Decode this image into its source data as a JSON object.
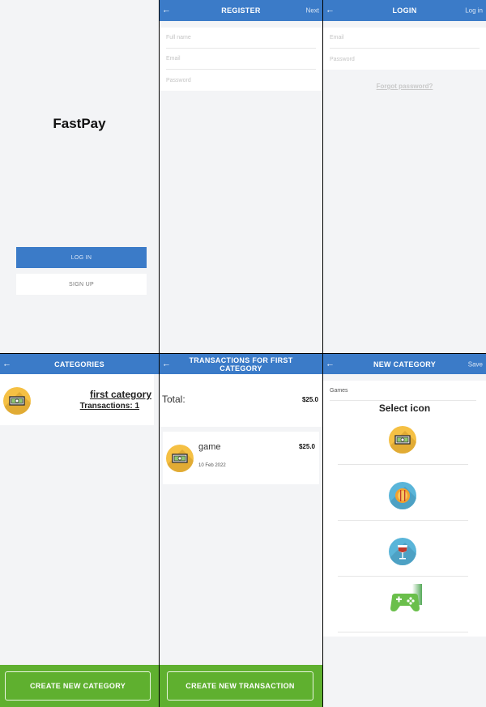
{
  "splash": {
    "brand": "FastPay",
    "login_label": "LOG IN",
    "signup_label": "SIGN UP"
  },
  "register": {
    "title": "REGISTER",
    "back_icon": "arrow-left-icon",
    "next_label": "Next",
    "fields": [
      {
        "placeholder": "Full name"
      },
      {
        "placeholder": "Email"
      },
      {
        "placeholder": "Password"
      }
    ]
  },
  "login": {
    "title": "LOGIN",
    "back_icon": "arrow-left-icon",
    "right_label": "Log in",
    "fields": [
      {
        "placeholder": "Email"
      },
      {
        "placeholder": "Password"
      }
    ],
    "forgot_label": "Forgot password?"
  },
  "categories": {
    "title": "CATEGORIES",
    "items": [
      {
        "name": "first category",
        "transactions_label": "Transactions: 1",
        "icon": "money-icon"
      }
    ],
    "create_label": "CREATE NEW CATEGORY"
  },
  "transactions": {
    "title": "TRANSACTIONS FOR FIRST CATEGORY",
    "total_label": "Total:",
    "total_value": "$25.0",
    "items": [
      {
        "name": "game",
        "date": "10 Feb 2022",
        "amount": "$25.0",
        "icon": "money-icon"
      }
    ],
    "create_label": "CREATE NEW TRANSACTION"
  },
  "new_category": {
    "title": "NEW CATEGORY",
    "save_label": "Save",
    "name_value": "Games",
    "select_icon_label": "Select icon",
    "icons": [
      "money-icon",
      "restaurant-icon",
      "wine-glass-icon",
      "gamepad-icon"
    ]
  },
  "colors": {
    "header_blue": "#3b7bc8",
    "action_green": "#5fb02f",
    "money_yellow": "#f5c044",
    "food_blue": "#5ab5d9",
    "wine_blue": "#5ab5d9",
    "game_green": "#4caf50"
  }
}
